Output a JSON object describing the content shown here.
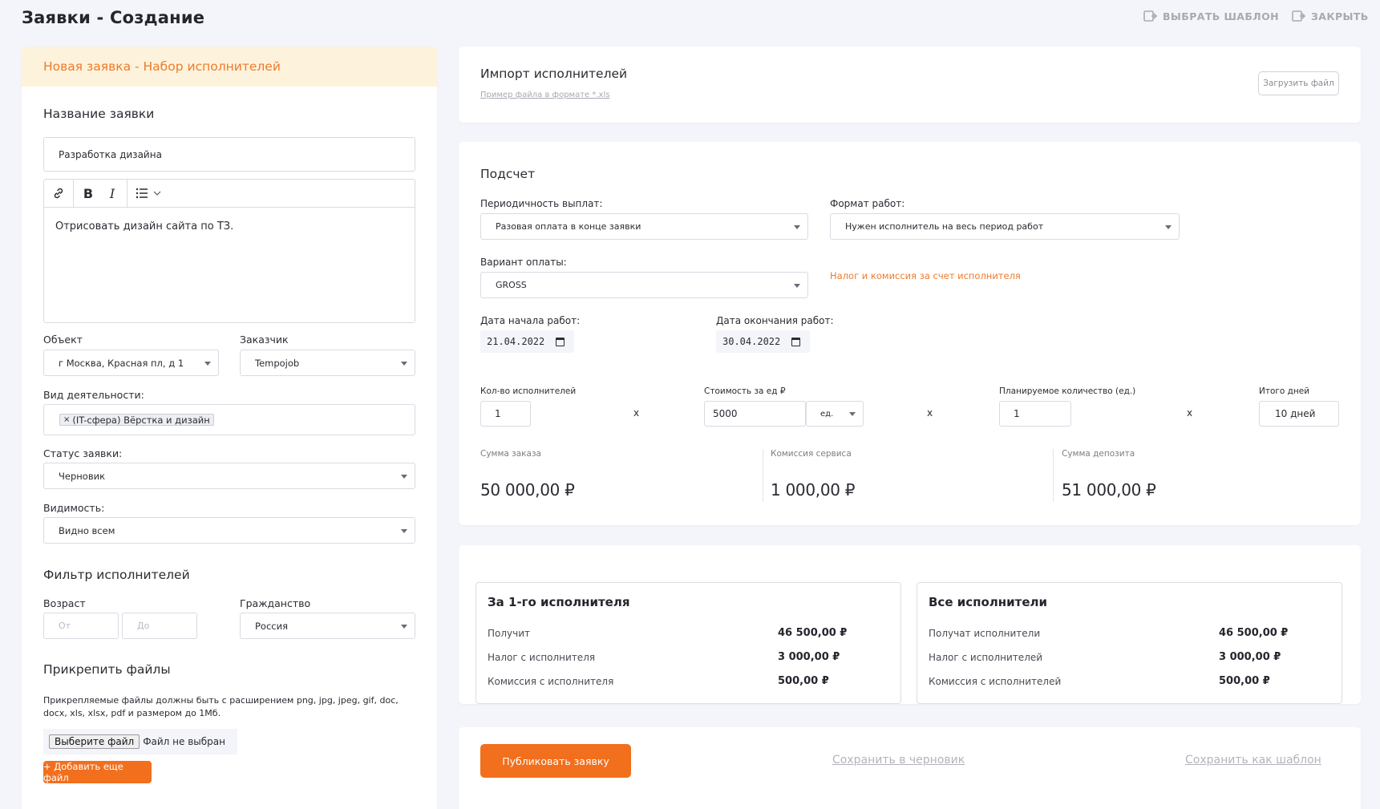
{
  "header": {
    "title": "Заявки - Создание",
    "choose_template": "ВЫБРАТЬ ШАБЛОН",
    "close": "ЗАКРЫТЬ"
  },
  "left": {
    "card_title": "Новая заявка - Набор исполнителей",
    "request_name_label": "Название заявки",
    "request_name_value": "Разработка дизайна",
    "description": "Отрисовать дизайн сайта по ТЗ.",
    "object_label": "Объект",
    "object_value": "г Москва, Красная пл, д 1",
    "customer_label": "Заказчик",
    "customer_value": "Tempojob",
    "activity_label": "Вид деятельности:",
    "activity_tag": "(IT-сфера) Вёрстка и дизайн",
    "status_label": "Статус заявки:",
    "status_value": "Черновик",
    "visibility_label": "Видимость:",
    "visibility_value": "Видно всем",
    "filter_title": "Фильтр исполнителей",
    "age_label": "Возраст",
    "age_from_placeholder": "От",
    "age_to_placeholder": "До",
    "citizenship_label": "Гражданство",
    "citizenship_value": "Россия",
    "attach_title": "Прикрепить файлы",
    "attach_hint": "Прикрепляемые файлы должны быть с расширением png, jpg, jpeg, gif, doc, docx, xls, xlsx, pdf и размером до 1Мб.",
    "choose_file_btn": "Выберите файл",
    "no_file_text": "Файл не выбран",
    "add_file_btn": "+ Добавить еще файл"
  },
  "import": {
    "title": "Импорт исполнителей",
    "example_link": "Пример файла в формате *.xls",
    "upload_btn": "Загрузить файл"
  },
  "calc": {
    "title": "Подсчет",
    "payment_period_label": "Периодичность выплат:",
    "payment_period_value": "Разовая оплата в конце заявки",
    "work_format_label": "Формат работ:",
    "work_format_value": "Нужен исполнитель на весь период работ",
    "payment_variant_label": "Вариант оплаты:",
    "payment_variant_value": "GROSS",
    "tax_note": "Налог и комиссия за счет исполнителя",
    "start_date_label": "Дата начала работ:",
    "start_date_value": "21.04.2022",
    "end_date_label": "Дата окончания работ:",
    "end_date_value": "30.04.2022",
    "workers_count_label": "Кол-во исполнителей",
    "workers_count_value": "1",
    "unit_price_label": "Стоимость за ед ₽",
    "unit_price_value": "5000",
    "unit_value": "ед.",
    "planned_qty_label": "Планируемое количество (ед.)",
    "planned_qty_value": "1",
    "total_days_label": "Итого дней",
    "total_days_value": "10 дней",
    "times": "x",
    "order_sum_label": "Сумма заказа",
    "order_sum_value": "50 000,00 ₽",
    "service_fee_label": "Комиссия сервиса",
    "service_fee_value": "1 000,00 ₽",
    "deposit_sum_label": "Сумма депозита",
    "deposit_sum_value": "51 000,00 ₽"
  },
  "summary": {
    "one": {
      "title": "За 1-го исполнителя",
      "rows": [
        {
          "label": "Получит",
          "value": "46 500,00 ₽"
        },
        {
          "label": "Налог с исполнителя",
          "value": "3 000,00 ₽"
        },
        {
          "label": "Комиссия с исполнителя",
          "value": "500,00 ₽"
        }
      ]
    },
    "all": {
      "title": "Все исполнители",
      "rows": [
        {
          "label": "Получат исполнители",
          "value": "46 500,00 ₽"
        },
        {
          "label": "Налог с исполнителей",
          "value": "3 000,00 ₽"
        },
        {
          "label": "Комиссия с исполнителей",
          "value": "500,00 ₽"
        }
      ]
    }
  },
  "actions": {
    "publish": "Публиковать заявку",
    "save_draft": "Сохранить в черновик",
    "save_template": "Сохранить как шаблон"
  },
  "colors": {
    "accent": "#f26f1d",
    "header_bg": "#fdf3dc",
    "page_bg": "#f4f5fa"
  }
}
